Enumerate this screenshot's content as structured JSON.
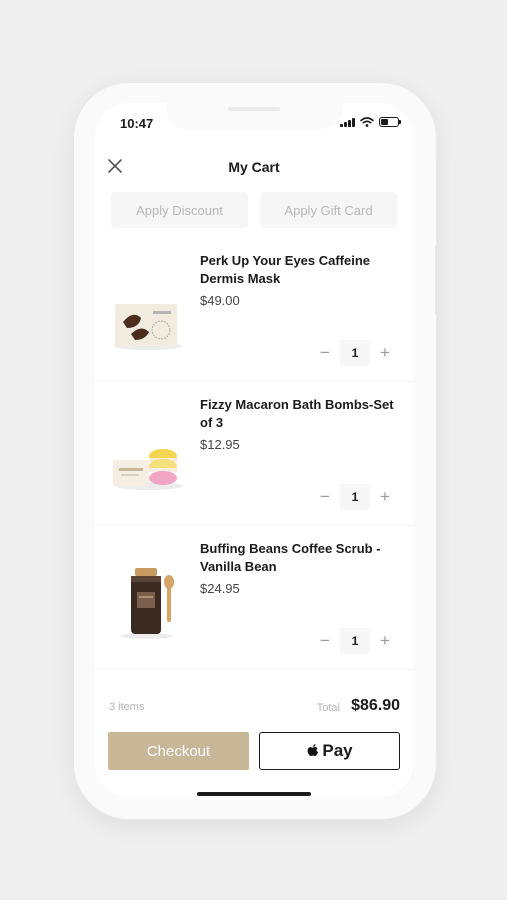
{
  "status_bar": {
    "time": "10:47"
  },
  "header": {
    "title": "My Cart"
  },
  "promo": {
    "discount_label": "Apply Discount",
    "gift_card_label": "Apply Gift Card"
  },
  "items": [
    {
      "name": "Perk Up Your Eyes Caffeine Dermis Mask",
      "price": "$49.00",
      "qty": "1"
    },
    {
      "name": "Fizzy Macaron Bath Bombs-Set of 3",
      "price": "$12.95",
      "qty": "1"
    },
    {
      "name": "Buffing Beans Coffee Scrub - Vanilla Bean",
      "price": "$24.95",
      "qty": "1"
    }
  ],
  "qty_controls": {
    "minus": "−",
    "plus": "+"
  },
  "summary": {
    "items_count": "3 items",
    "total_label": "Total",
    "total_value": "$86.90"
  },
  "actions": {
    "checkout_label": "Checkout",
    "apple_pay_label": "Pay"
  },
  "icons": {
    "close": "close-icon",
    "signal": "signal-icon",
    "wifi": "wifi-icon",
    "battery": "battery-icon",
    "apple": "apple-logo-icon"
  },
  "colors": {
    "checkout_button": "#c8b796",
    "background": "#efefef",
    "text": "#1b1b1b"
  }
}
